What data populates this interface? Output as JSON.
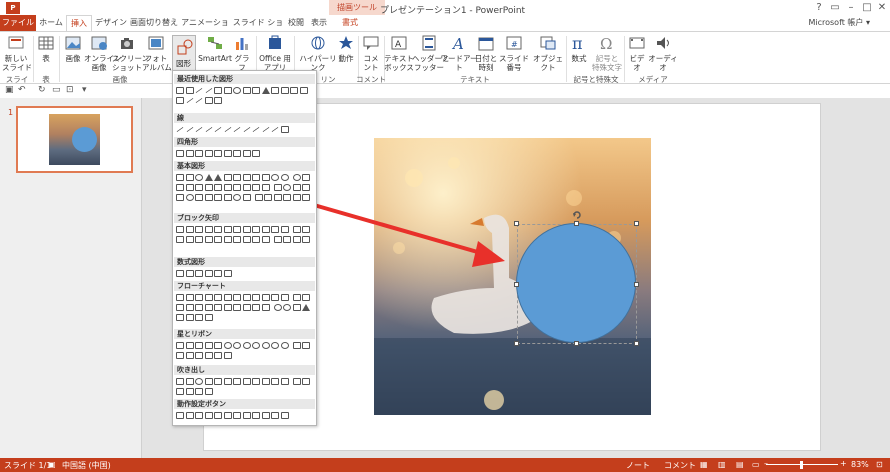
{
  "titlebar": {
    "title": "プレゼンテーション1 - PowerPoint",
    "context_tab": "描画ツール",
    "controls": [
      "?",
      "▭",
      "–",
      "□",
      "✕"
    ]
  },
  "tabs": [
    "ファイル",
    "ホーム",
    "挿入",
    "デザイン",
    "画面切り替え",
    "アニメーション",
    "スライド ショー",
    "校閲",
    "表示",
    "書式"
  ],
  "account": "Microsoft 帳户 ▾",
  "ribbon": {
    "new_slide": "新しい\nスライド",
    "table": "表",
    "image": "画像",
    "online_image": "オンライン\n画像",
    "screenshot": "スクリーン\nショット",
    "photo_album": "フォト\nアルバム",
    "shapes": "図形",
    "smartart": "SmartArt",
    "graph": "グラフ",
    "office_app": "Office 用\nアプリ",
    "hyperlink": "ハイパーリンク",
    "action": "動作",
    "comment": "コメント",
    "textbox": "テキスト\nボックス",
    "header_footer": "ヘッダーと\nフッター",
    "wordart": "ワードアート",
    "datetime": "日付と\n時刻",
    "slide_number": "スライド番号",
    "object": "オブジェクト",
    "equation": "数式",
    "symbol": "記号と\n特殊文字",
    "video": "ビデオ",
    "audio": "オーディオ",
    "groups": {
      "slides": "スライド",
      "table": "表",
      "images": "画像",
      "link": "リンク",
      "comment": "コメント",
      "text": "テキスト",
      "symbols": "記号と特殊文字",
      "media": "メディア"
    }
  },
  "dropdown": {
    "categories": [
      "最近使用した図形",
      "線",
      "四角形",
      "基本図形",
      "ブロック矢印",
      "数式図形",
      "フローチャート",
      "星とリボン",
      "吹き出し",
      "動作設定ボタン"
    ]
  },
  "thumbnail": {
    "number": "1"
  },
  "statusbar": {
    "slide": "スライド 1/1",
    "language": "中国語 (中国)",
    "notes": "ノート",
    "comments": "コメント",
    "zoom": "83%"
  },
  "colors": {
    "accent": "#c43e1c",
    "shape_fill": "#5b9bd5",
    "arrow": "#e8302a"
  }
}
